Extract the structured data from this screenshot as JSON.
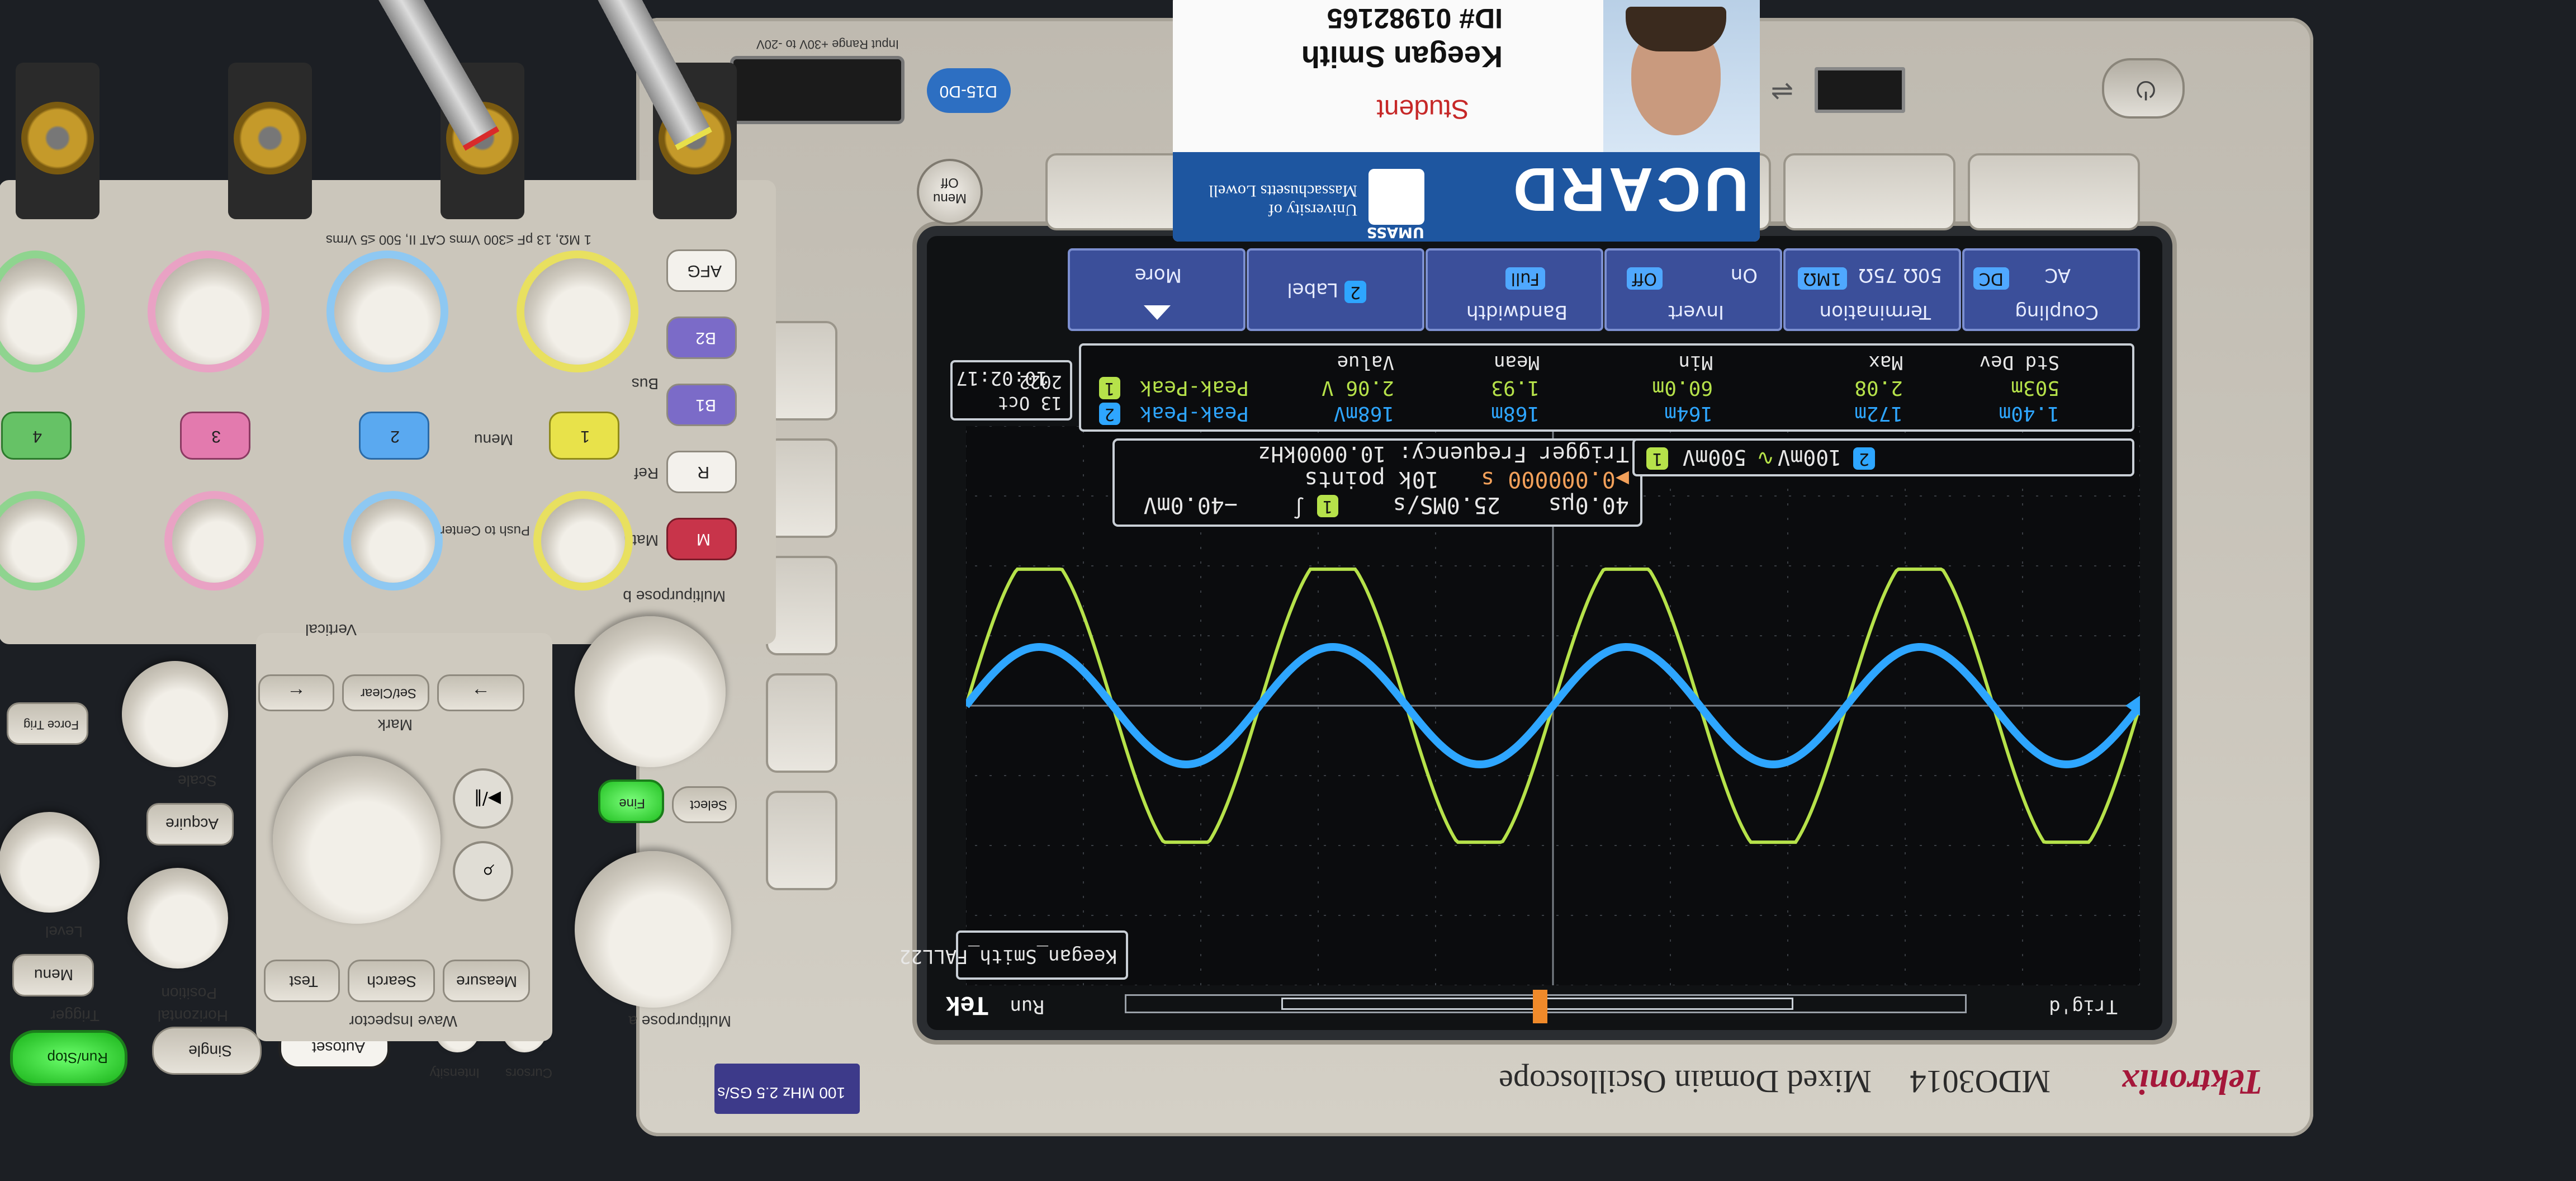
{
  "scope": {
    "brand": "Tektronix",
    "model": "MDO3014",
    "model_desc": "Mixed Domain Oscilloscope",
    "spec": "100 MHz 2.5 GS/s",
    "port_label": "D15-D0",
    "input_range": "Input Range +30V to -20V",
    "probe_spec": "1 MΩ, 13 pF ≤300 Vrms CAT II, 500 ≤5 Vrms"
  },
  "screen": {
    "tek": "Tek",
    "run_state": "Run",
    "trig_state": "Trig'd",
    "label_box": "Keegan_Smith_FALL22",
    "date": "13 Oct 2022",
    "time": "10:02:17",
    "menu": {
      "coupling_label": "Coupling",
      "coupling_dc": "DC",
      "coupling_ac": "AC",
      "termination_label": "Termination",
      "term_1m": "1MΩ",
      "term_75": "75Ω",
      "term_50": "50Ω",
      "invert_label": "Invert",
      "invert_on": "On",
      "invert_off": "Off",
      "bandwidth_label": "Bandwidth",
      "bandwidth_value": "Full",
      "label_label": "Label",
      "more_label": "More"
    },
    "measure": {
      "headers": [
        "Value",
        "Mean",
        "Min",
        "Max",
        "Std Dev"
      ],
      "ch1_tag": "1",
      "ch1_name": "Peak-Peak",
      "ch1_values": [
        "2.06 V",
        "1.93",
        "60.0m",
        "2.08",
        "503m"
      ],
      "ch2_tag": "2",
      "ch2_name": "Peak-Peak",
      "ch2_values": [
        "168mV",
        "168m",
        "164m",
        "172m",
        "1.40m"
      ]
    },
    "channels": {
      "ch1_tag": "1",
      "ch1_scale": "500mV",
      "ch1_coupling_symbol": "∿",
      "ch2_tag": "2",
      "ch2_scale": "100mV"
    },
    "trigger_box": {
      "timebase": "40.0µs",
      "sample_rate": "25.0MS/s",
      "points": "10k points",
      "trig_src": "1",
      "trig_slope": "∫",
      "trig_level": "−40.0mV",
      "position": "▶0.000000 s",
      "trig_freq": "Trigger Frequency: 10.0000kHz"
    },
    "waves": {
      "ch1_amplitude_div": 2.1,
      "ch2_amplitude_div": 0.84,
      "cycles_visible": 4
    },
    "colors": {
      "ch1": "#b6e24a",
      "ch2": "#2ea6ff",
      "grid": "#3a3e44",
      "menu": "#3b4f9a"
    }
  },
  "front_panel": {
    "vertical_label": "Vertical",
    "horizontal_label": "Horizontal",
    "trigger_label": "Trigger",
    "wave_inspector_label": "Wave Inspector",
    "bus_label": "Bus",
    "ref_label": "Ref",
    "math_label": "Math",
    "menu_label": "Menu",
    "position_label": "Position",
    "push_center": "Push to Center",
    "scale_label": "Scale",
    "level_label": "Level",
    "multipurpose_a": "Multipurpose a",
    "multipurpose_b": "Multipurpose b",
    "buttons": {
      "afg": "AFG",
      "b1": "B1",
      "b2": "B2",
      "r": "R",
      "m": "M",
      "ch1": "1",
      "ch2": "2",
      "ch3": "3",
      "ch4": "4",
      "run_stop": "Run/Stop",
      "single": "Single",
      "autoset": "Autoset",
      "intensity": "Intensity",
      "cursors": "Cursors",
      "select": "Select",
      "fine": "Fine",
      "measure": "Measure",
      "search": "Search",
      "test": "Test",
      "set_clear": "Set/Clear",
      "mark": "Mark",
      "play_pause": "▶/‖",
      "menu_off": "Menu Off",
      "acquire": "Acquire",
      "force_trig": "Force Trig",
      "menu": "Menu"
    }
  },
  "id_card": {
    "org": "University of Massachusetts Lowell",
    "umass": "UMASS",
    "brand": "UCARD",
    "role": "Student",
    "name": "Keegan Smith",
    "id": "ID# 01982165"
  }
}
